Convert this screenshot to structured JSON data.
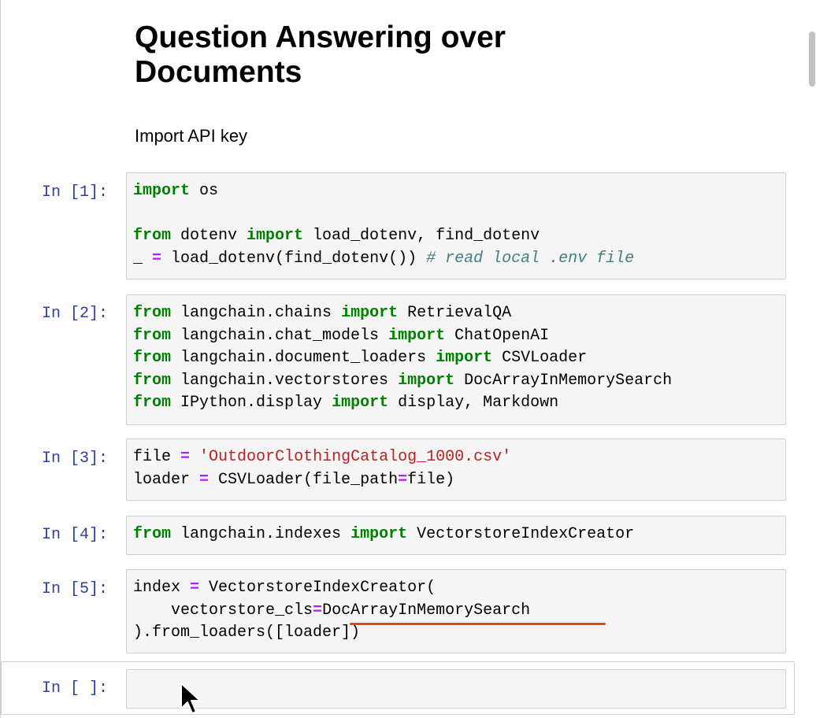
{
  "markdown": {
    "title": "Question Answering over Documents",
    "subtitle": "Import API key"
  },
  "cells": [
    {
      "prompt": "In [1]:",
      "lines": [
        [
          {
            "t": "kw",
            "v": "import"
          },
          {
            "t": "n",
            "v": " os"
          }
        ],
        [],
        [
          {
            "t": "kw",
            "v": "from"
          },
          {
            "t": "n",
            "v": " dotenv "
          },
          {
            "t": "kw",
            "v": "import"
          },
          {
            "t": "n",
            "v": " load_dotenv, find_dotenv"
          }
        ],
        [
          {
            "t": "n",
            "v": "_ "
          },
          {
            "t": "op",
            "v": "="
          },
          {
            "t": "n",
            "v": " load_dotenv(find_dotenv()) "
          },
          {
            "t": "cm",
            "v": "# read local .env file"
          }
        ]
      ]
    },
    {
      "prompt": "In [2]:",
      "lines": [
        [
          {
            "t": "kw",
            "v": "from"
          },
          {
            "t": "n",
            "v": " langchain.chains "
          },
          {
            "t": "kw",
            "v": "import"
          },
          {
            "t": "n",
            "v": " RetrievalQA"
          }
        ],
        [
          {
            "t": "kw",
            "v": "from"
          },
          {
            "t": "n",
            "v": " langchain.chat_models "
          },
          {
            "t": "kw",
            "v": "import"
          },
          {
            "t": "n",
            "v": " ChatOpenAI"
          }
        ],
        [
          {
            "t": "kw",
            "v": "from"
          },
          {
            "t": "n",
            "v": " langchain.document_loaders "
          },
          {
            "t": "kw",
            "v": "import"
          },
          {
            "t": "n",
            "v": " CSVLoader"
          }
        ],
        [
          {
            "t": "kw",
            "v": "from"
          },
          {
            "t": "n",
            "v": " langchain.vectorstores "
          },
          {
            "t": "kw",
            "v": "import"
          },
          {
            "t": "n",
            "v": " DocArrayInMemorySearch"
          }
        ],
        [
          {
            "t": "kw",
            "v": "from"
          },
          {
            "t": "n",
            "v": " IPython.display "
          },
          {
            "t": "kw",
            "v": "import"
          },
          {
            "t": "n",
            "v": " display, Markdown"
          }
        ]
      ]
    },
    {
      "prompt": "In [3]:",
      "lines": [
        [
          {
            "t": "n",
            "v": "file "
          },
          {
            "t": "op",
            "v": "="
          },
          {
            "t": "n",
            "v": " "
          },
          {
            "t": "str",
            "v": "'OutdoorClothingCatalog_1000.csv'"
          }
        ],
        [
          {
            "t": "n",
            "v": "loader "
          },
          {
            "t": "op",
            "v": "="
          },
          {
            "t": "n",
            "v": " CSVLoader(file_path"
          },
          {
            "t": "op",
            "v": "="
          },
          {
            "t": "n",
            "v": "file)"
          }
        ]
      ]
    },
    {
      "prompt": "In [4]:",
      "lines": [
        [
          {
            "t": "kw",
            "v": "from"
          },
          {
            "t": "n",
            "v": " langchain.indexes "
          },
          {
            "t": "kw",
            "v": "import"
          },
          {
            "t": "n",
            "v": " VectorstoreIndexCreator"
          }
        ]
      ]
    },
    {
      "prompt": "In [5]:",
      "lines": [
        [
          {
            "t": "n",
            "v": "index "
          },
          {
            "t": "op",
            "v": "="
          },
          {
            "t": "n",
            "v": " VectorstoreIndexCreator("
          }
        ],
        [
          {
            "t": "n",
            "v": "    vectorstore_cls"
          },
          {
            "t": "op",
            "v": "="
          },
          {
            "t": "n",
            "v": "DocArrayInMemorySearch"
          }
        ],
        [
          {
            "t": "n",
            "v": ").from_loaders([loader])"
          }
        ]
      ]
    },
    {
      "prompt": "In [ ]:",
      "lines": []
    }
  ],
  "colors": {
    "keyword": "#008000",
    "operator": "#aa22ff",
    "string": "#ba2121",
    "comment": "#408080",
    "prompt": "#303f9f",
    "annotation_underline": "#e0442a"
  }
}
